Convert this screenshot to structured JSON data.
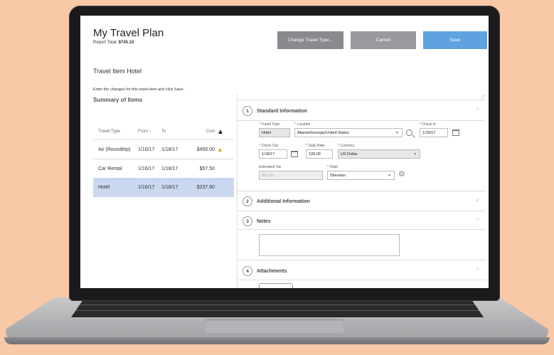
{
  "app": {
    "title": "My Travel Plan",
    "report_total_label": "Report Total:",
    "report_total_value": "$745.10"
  },
  "toolbar": {
    "change_label": "Change Travel Type...",
    "cancel_label": "Cancel",
    "save_label": "Save"
  },
  "main": {
    "item_heading": "Travel Item Hotel",
    "instruction": "Enter the changes for this travel item and click Save.",
    "summary_heading": "Summary of Items"
  },
  "table": {
    "headers": [
      "Travel Type",
      "From",
      "To",
      "Cost"
    ],
    "sort_icon": "↑",
    "rows": [
      {
        "type": "Air (Roundtrip)",
        "from": "1/10/17",
        "to": "1/18/17",
        "cost": "$450.00",
        "warning": true
      },
      {
        "type": "Car Rental",
        "from": "1/16/17",
        "to": "1/18/17",
        "cost": "$57.50",
        "warning": false
      },
      {
        "type": "Hotel",
        "from": "1/16/17",
        "to": "1/18/17",
        "cost": "$237.60",
        "warning": false
      }
    ]
  },
  "sections": {
    "standard": {
      "number": "1",
      "title": "Standard Information"
    },
    "additional": {
      "number": "2",
      "title": "Additional Information"
    },
    "notes": {
      "number": "3",
      "title": "Notes"
    },
    "attachments": {
      "number": "4",
      "title": "Attachments"
    }
  },
  "form": {
    "travel_type": {
      "label": "Travel Type",
      "value": "Hotel"
    },
    "location": {
      "label": "Location",
      "value": "Atlanta/Georgia/United States"
    },
    "check_in": {
      "label": "Check In",
      "value": "1/16/17"
    },
    "check_out": {
      "label": "Check Out",
      "value": "1/18/17"
    },
    "daily_rate": {
      "label": "Daily Rate",
      "value": "108.00"
    },
    "currency": {
      "label": "Currency",
      "value": "US Dollar"
    },
    "estimated_tax": {
      "label": "Estimated Tax",
      "value": "$10.80"
    },
    "hotel": {
      "label": "Hotel",
      "value": "Sheraton"
    }
  },
  "colors": {
    "save": "#5fa2df",
    "selected_row": "#c9d8ee",
    "warning": "#f0a020",
    "required": "#dd3333"
  }
}
